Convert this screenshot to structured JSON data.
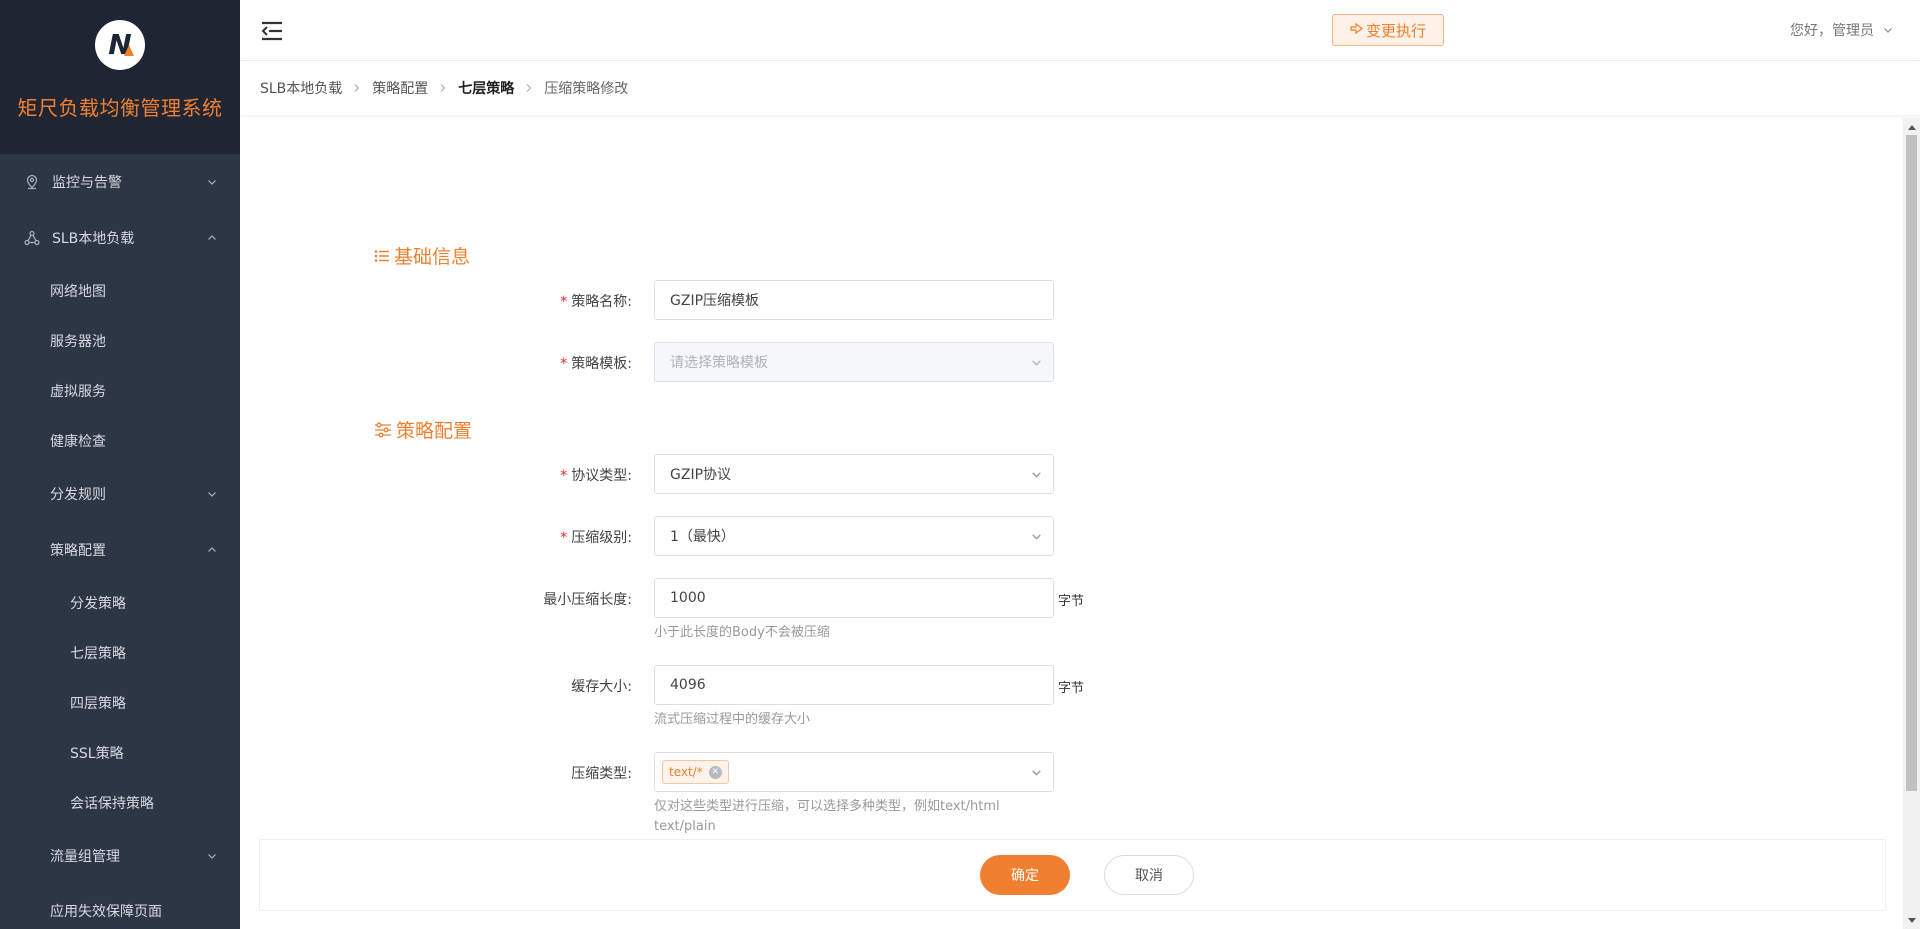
{
  "app": {
    "title": "矩尺负载均衡管理系统",
    "logo_icon": "brand-logo-icon"
  },
  "sidebar": {
    "items": [
      {
        "label": "监控与告警",
        "icon": "location-pin-icon",
        "expanded": false
      },
      {
        "label": "SLB本地负载",
        "icon": "network-nodes-icon",
        "expanded": true
      },
      {
        "label": "网络地图"
      },
      {
        "label": "服务器池"
      },
      {
        "label": "虚拟服务"
      },
      {
        "label": "健康检查"
      },
      {
        "label": "分发规则",
        "expanded": false
      },
      {
        "label": "策略配置",
        "expanded": true
      },
      {
        "label": "分发策略"
      },
      {
        "label": "七层策略"
      },
      {
        "label": "四层策略"
      },
      {
        "label": "SSL策略"
      },
      {
        "label": "会话保持策略"
      },
      {
        "label": "流量组管理",
        "expanded": false
      },
      {
        "label": "应用失效保障页面"
      }
    ]
  },
  "header": {
    "change_button": "变更执行",
    "greeting": "您好，管理员"
  },
  "breadcrumb": [
    "SLB本地负载",
    "策略配置",
    "七层策略",
    "压缩策略修改"
  ],
  "sections": {
    "basic": "基础信息",
    "config": "策略配置"
  },
  "form": {
    "policy_name": {
      "label": "策略名称:",
      "value": "GZIP压缩模板"
    },
    "policy_template": {
      "label": "策略模板:",
      "placeholder": "请选择策略模板"
    },
    "protocol_type": {
      "label": "协议类型:",
      "value": "GZIP协议"
    },
    "compress_level": {
      "label": "压缩级别:",
      "value": "1（最快）"
    },
    "min_length": {
      "label": "最小压缩长度:",
      "value": "1000",
      "unit": "字节",
      "hint": "小于此长度的Body不会被压缩"
    },
    "cache_size": {
      "label": "缓存大小:",
      "value": "4096",
      "unit": "字节",
      "hint": "流式压缩过程中的缓存大小"
    },
    "compress_type": {
      "label": "压缩类型:",
      "tags": [
        "text/*"
      ],
      "hint": "仅对这些类型进行压缩，可以选择多种类型，例如text/html text/plain"
    }
  },
  "footer": {
    "ok": "确定",
    "cancel": "取消"
  },
  "colors": {
    "accent": "#f08030",
    "sidebar_bg": "#2d3645",
    "brand_bg": "#1f2532",
    "required": "#f5222d"
  }
}
